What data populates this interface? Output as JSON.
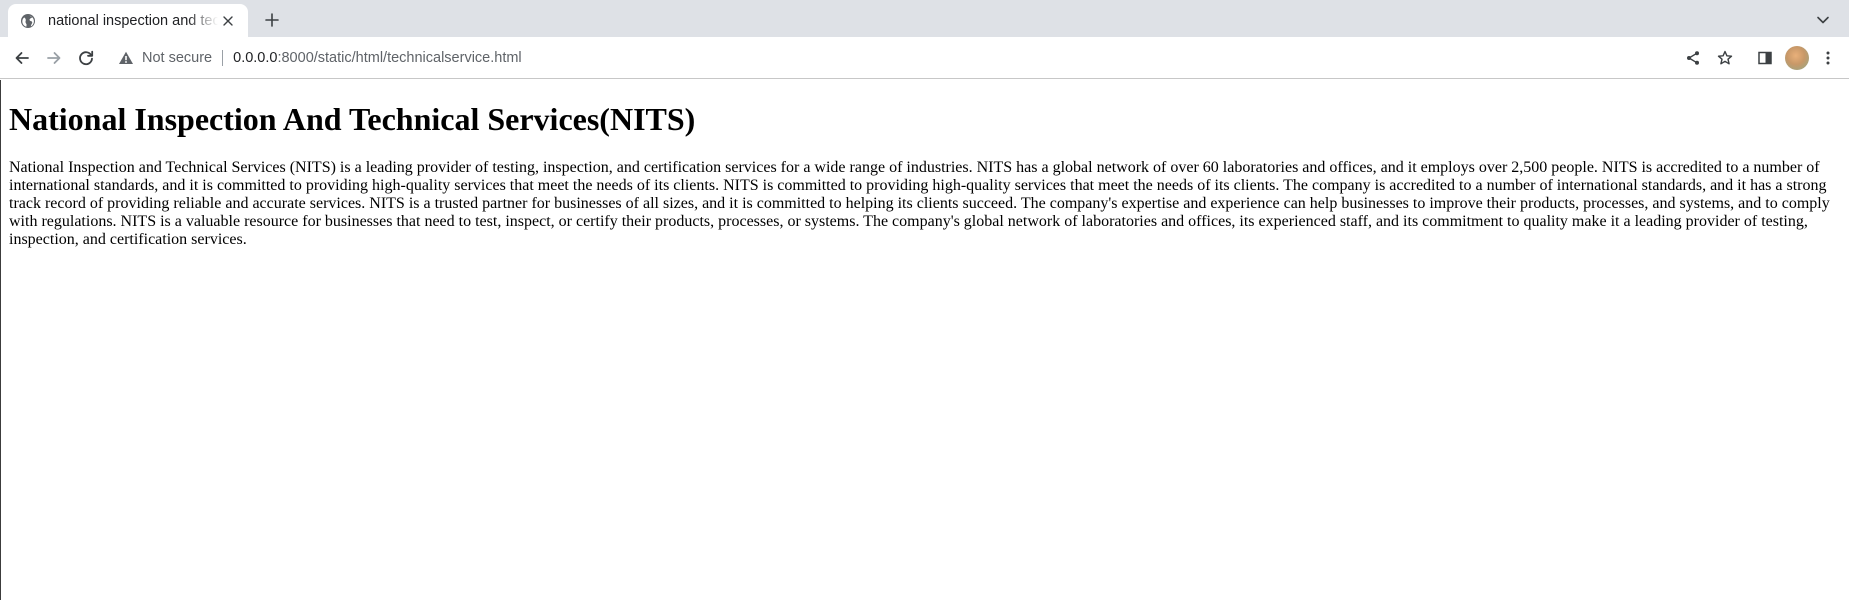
{
  "browser": {
    "tab": {
      "title": "national inspection and technical services",
      "favicon_icon": "globe-icon",
      "close_icon": "close-icon"
    },
    "new_tab_icon": "plus-icon",
    "tab_list_icon": "chevron-down-icon",
    "toolbar": {
      "back_icon": "arrow-left-icon",
      "forward_icon": "arrow-right-icon",
      "reload_icon": "reload-icon",
      "security_icon": "warning-icon",
      "security_label": "Not secure",
      "url_host": "0.0.0.0",
      "url_rest": ":8000/static/html/technicalservice.html",
      "share_icon": "share-icon",
      "bookmark_icon": "star-icon",
      "side_panel_icon": "side-panel-icon",
      "profile_icon": "avatar",
      "menu_icon": "kebab-menu-icon"
    },
    "colors": {
      "tabstrip_bg": "#dee1e6",
      "toolbar_bg": "#ffffff",
      "text_primary": "#202124",
      "text_secondary": "#5f6368"
    }
  },
  "page": {
    "heading": "National Inspection And Technical Services(NITS)",
    "body": "National Inspection and Technical Services (NITS) is a leading provider of testing, inspection, and certification services for a wide range of industries. NITS has a global network of over 60 laboratories and offices, and it employs over 2,500 people. NITS is accredited to a number of international standards, and it is committed to providing high-quality services that meet the needs of its clients. NITS is committed to providing high-quality services that meet the needs of its clients. The company is accredited to a number of international standards, and it has a strong track record of providing reliable and accurate services. NITS is a trusted partner for businesses of all sizes, and it is committed to helping its clients succeed. The company's expertise and experience can help businesses to improve their products, processes, and systems, and to comply with regulations. NITS is a valuable resource for businesses that need to test, inspect, or certify their products, processes, or systems. The company's global network of laboratories and offices, its experienced staff, and its commitment to quality make it a leading provider of testing, inspection, and certification services."
  }
}
